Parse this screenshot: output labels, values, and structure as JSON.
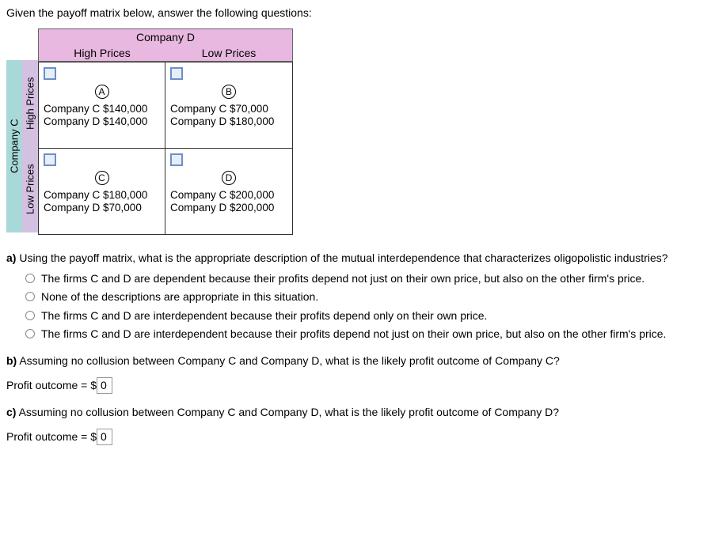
{
  "intro": "Given the payoff matrix below, answer the following questions:",
  "matrix": {
    "col_company": "Company D",
    "row_company": "Company C",
    "col_labels": [
      "High Prices",
      "Low Prices"
    ],
    "row_labels": [
      "High Prices",
      "Low Prices"
    ],
    "cells": [
      {
        "letter": "A",
        "lines": [
          "Company C $140,000",
          "Company D $140,000"
        ]
      },
      {
        "letter": "B",
        "lines": [
          "Company C $70,000",
          "Company D $180,000"
        ]
      },
      {
        "letter": "C",
        "lines": [
          "Company C $180,000",
          "Company D $70,000"
        ]
      },
      {
        "letter": "D",
        "lines": [
          "Company C $200,000",
          "Company D $200,000"
        ]
      }
    ]
  },
  "questions": {
    "a": {
      "label": "a)",
      "text": "Using the payoff matrix, what is the appropriate description of the mutual interdependence that characterizes oligopolistic industries?",
      "options": [
        "The firms C and D are dependent because their profits depend not just on their own price, but also on the other firm's price.",
        "None of the descriptions are appropriate in this situation.",
        "The firms C and D are interdependent because their profits depend only on their own price.",
        "The firms C and D are interdependent because their profits depend not just on their own price, but also on the other firm's price."
      ]
    },
    "b": {
      "label": "b)",
      "text": "Assuming no collusion between Company C and Company D, what is the likely profit outcome of Company C?",
      "answer_label": "Profit outcome = $",
      "answer_value": "0"
    },
    "c": {
      "label": "c)",
      "text": "Assuming no collusion between Company C and Company D, what is the likely profit outcome of Company D?",
      "answer_label": "Profit outcome = $",
      "answer_value": "0"
    }
  },
  "chart_data": {
    "type": "table",
    "title": "Payoff Matrix",
    "row_player": "Company C",
    "col_player": "Company D",
    "row_strategies": [
      "High Prices",
      "Low Prices"
    ],
    "col_strategies": [
      "High Prices",
      "Low Prices"
    ],
    "payoffs": [
      [
        {
          "C": 140000,
          "D": 140000
        },
        {
          "C": 70000,
          "D": 180000
        }
      ],
      [
        {
          "C": 180000,
          "D": 70000
        },
        {
          "C": 200000,
          "D": 200000
        }
      ]
    ]
  }
}
